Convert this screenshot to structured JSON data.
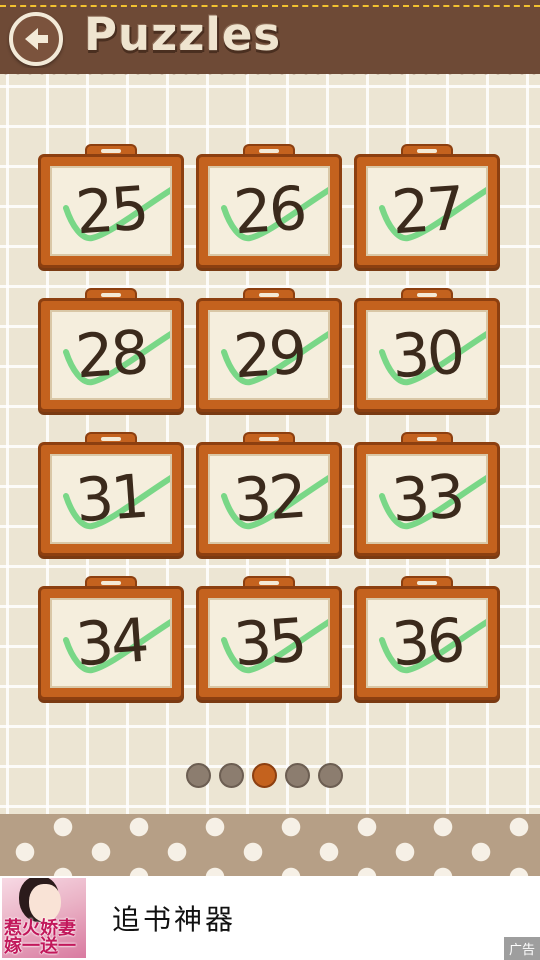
{
  "header": {
    "title": "Puzzles",
    "back_icon": "back-arrow-icon"
  },
  "puzzles": [
    {
      "number": "25",
      "completed": true
    },
    {
      "number": "26",
      "completed": true
    },
    {
      "number": "27",
      "completed": true
    },
    {
      "number": "28",
      "completed": true
    },
    {
      "number": "29",
      "completed": true
    },
    {
      "number": "30",
      "completed": true
    },
    {
      "number": "31",
      "completed": true
    },
    {
      "number": "32",
      "completed": true
    },
    {
      "number": "33",
      "completed": true
    },
    {
      "number": "34",
      "completed": true
    },
    {
      "number": "35",
      "completed": true
    },
    {
      "number": "36",
      "completed": true
    }
  ],
  "pagination": {
    "total_pages": 5,
    "current_page": 3
  },
  "ad": {
    "title": "追书神器",
    "thumbnail_text": "惹火娇妻 嫁一送一",
    "tag": "广告"
  },
  "colors": {
    "header_brown": "#6e4a36",
    "frame_orange": "#c4621e",
    "check_green": "#4fcf6a",
    "background": "#ece5d3"
  }
}
